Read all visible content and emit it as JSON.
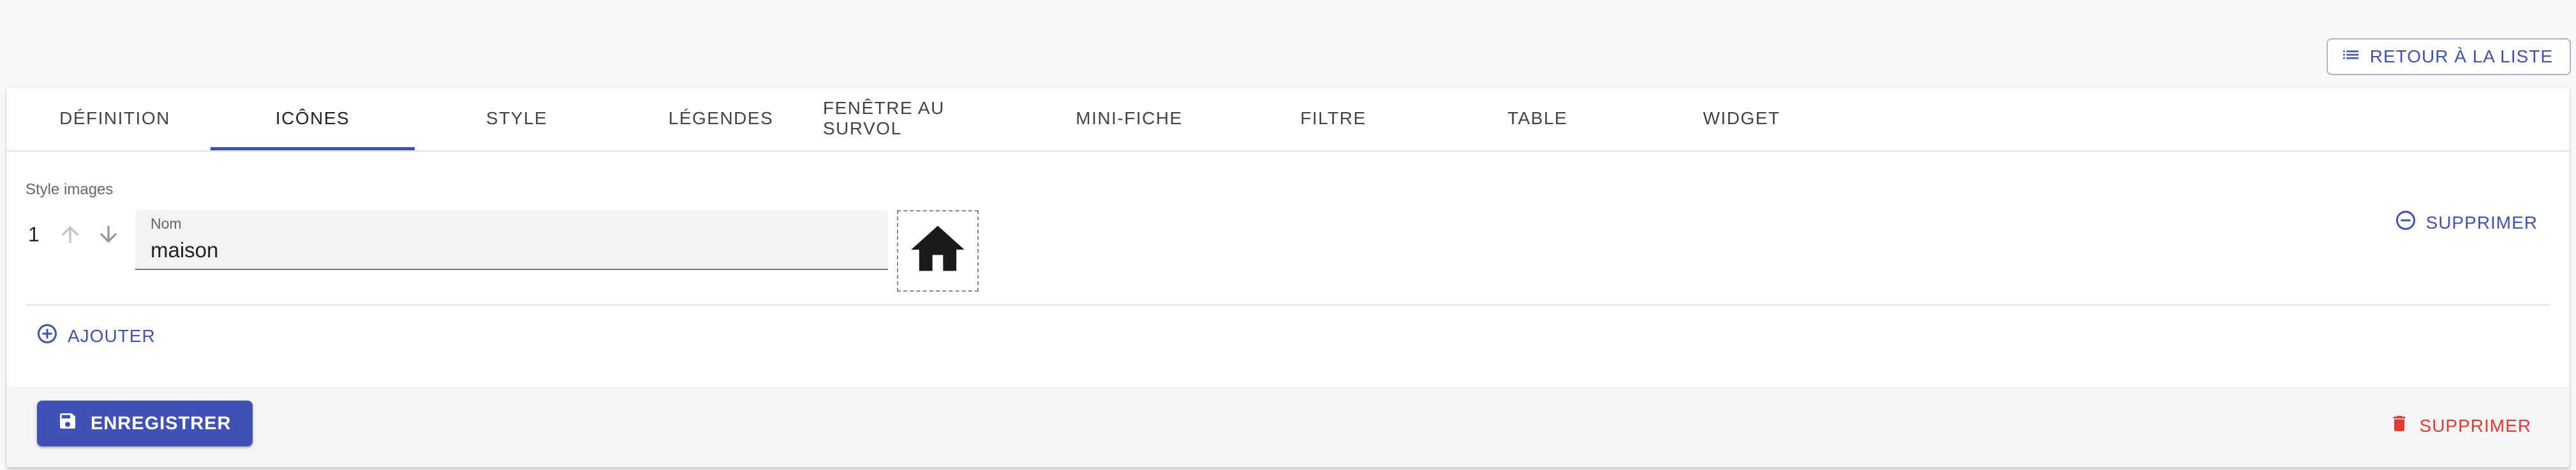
{
  "header": {
    "back_label": "RETOUR À LA LISTE",
    "back_icon": "list-icon"
  },
  "tabs": [
    {
      "label": "DÉFINITION"
    },
    {
      "label": "ICÔNES",
      "active": true
    },
    {
      "label": "STYLE"
    },
    {
      "label": "LÉGENDES"
    },
    {
      "label": "FENÊTRE AU SURVOL"
    },
    {
      "label": "MINI-FICHE"
    },
    {
      "label": "FILTRE"
    },
    {
      "label": "TABLE"
    },
    {
      "label": "WIDGET"
    }
  ],
  "section": {
    "label": "Style images",
    "rows": [
      {
        "index": "1",
        "name_label": "Nom",
        "name_value": "maison",
        "icon": "house-icon",
        "delete_label": "SUPPRIMER"
      }
    ],
    "add_label": "AJOUTER"
  },
  "footer": {
    "save_label": "ENREGISTRER",
    "delete_label": "SUPPRIMER"
  },
  "colors": {
    "primary": "#3f51b5",
    "danger": "#e53935"
  }
}
